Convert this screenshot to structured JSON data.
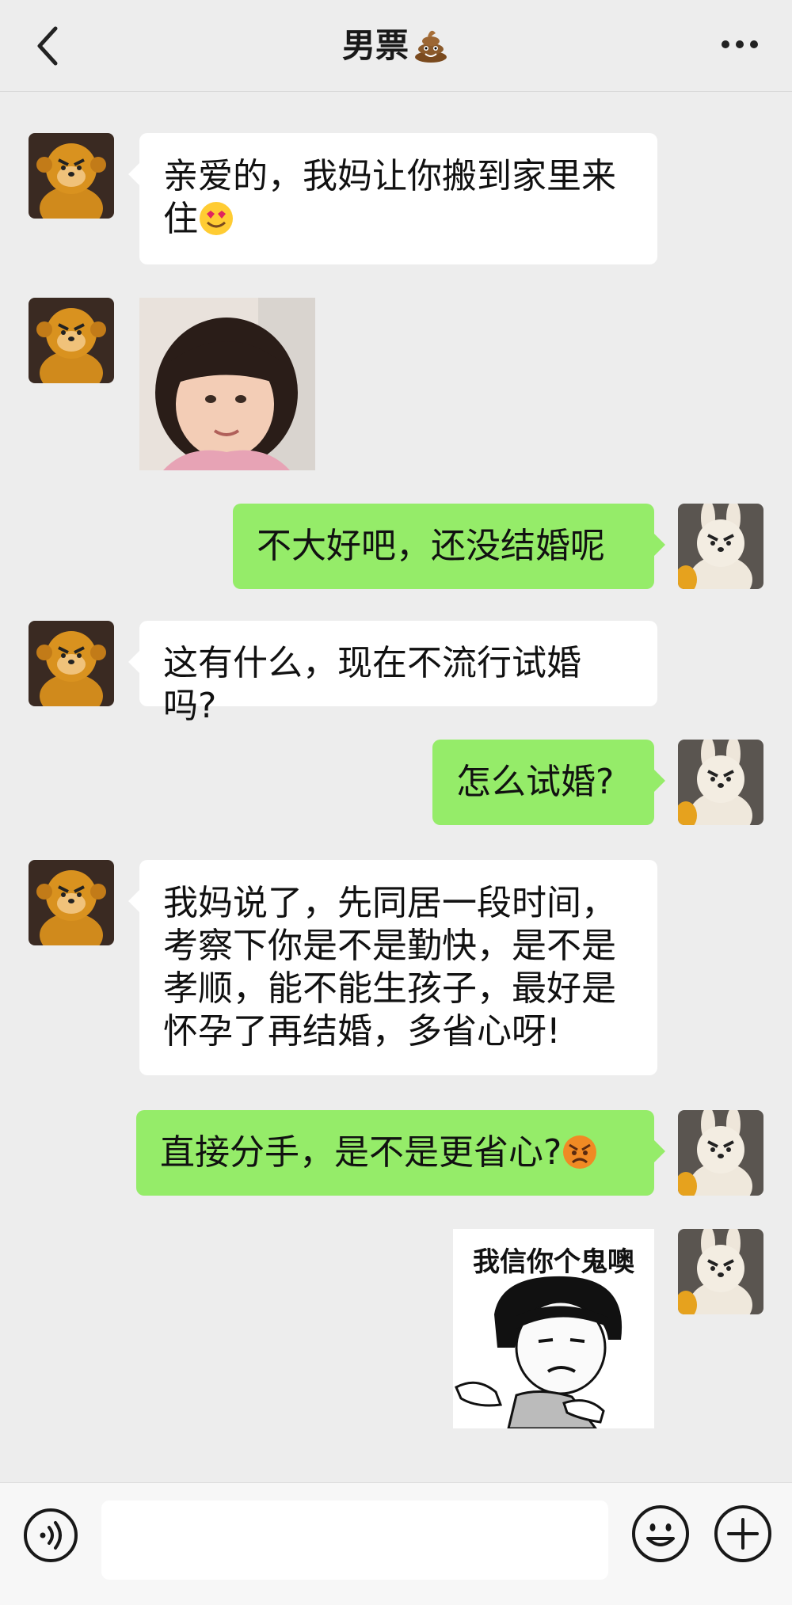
{
  "header": {
    "title": "男票",
    "title_emoji": "pile-of-poo-icon"
  },
  "messages": [
    {
      "side": "left",
      "type": "text",
      "text_line1": "亲爱的，我妈让你搬到家里来",
      "text_line2": "住",
      "emoji": "smiling-heart-eyes-icon"
    },
    {
      "side": "left",
      "type": "image",
      "image": "girl-photo"
    },
    {
      "side": "right",
      "type": "text",
      "text": "不大好吧，还没结婚呢"
    },
    {
      "side": "left",
      "type": "text",
      "text": "这有什么，现在不流行试婚吗?"
    },
    {
      "side": "right",
      "type": "text",
      "text": "怎么试婚?"
    },
    {
      "side": "left",
      "type": "text",
      "lines": [
        "我妈说了，先同居一段时间，",
        "考察下你是不是勤快，是不是",
        "孝顺，能不能生孩子，最好是",
        "怀孕了再结婚，多省心呀!"
      ]
    },
    {
      "side": "right",
      "type": "text",
      "text": "直接分手，是不是更省心?",
      "emoji": "angry-face-icon"
    },
    {
      "side": "right",
      "type": "sticker",
      "caption": "我信你个鬼噢"
    }
  ],
  "colors": {
    "background": "#ededed",
    "left_bubble": "#ffffff",
    "right_bubble": "#95ec69"
  }
}
